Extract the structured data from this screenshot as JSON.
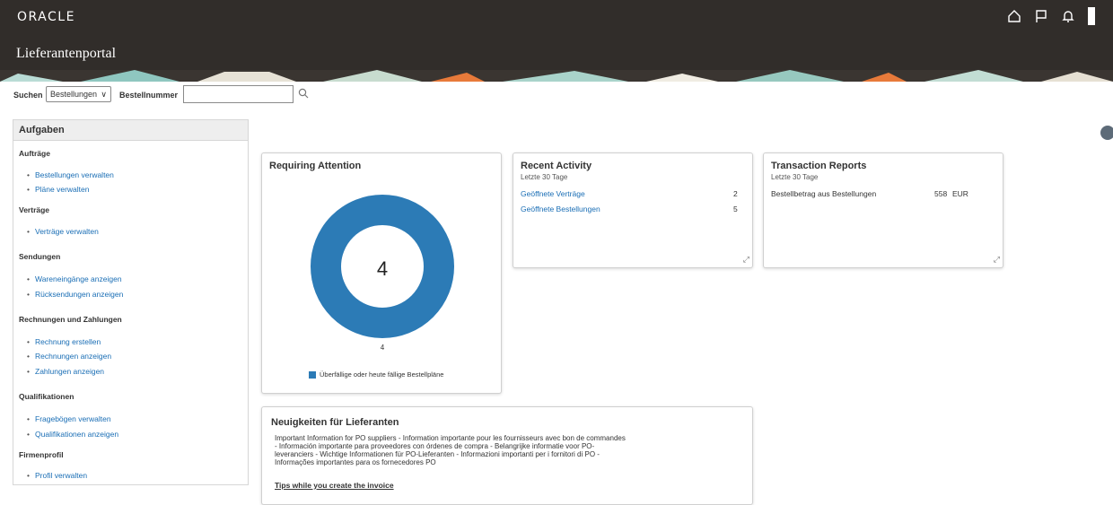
{
  "header": {
    "logo": "ORACLE",
    "app_title": "Lieferantenportal",
    "icons": [
      "home-icon",
      "flag-icon",
      "bell-icon"
    ]
  },
  "search": {
    "label": "Suchen",
    "selected": "Bestellungen",
    "field_label": "Bestellnummer",
    "value": ""
  },
  "tasks": {
    "title": "Aufgaben",
    "groups": [
      {
        "label": "Aufträge",
        "items": [
          "Bestellungen verwalten",
          "Pläne verwalten"
        ]
      },
      {
        "label": "Verträge",
        "items": [
          "Verträge verwalten"
        ]
      },
      {
        "label": "Sendungen",
        "items": [
          "Wareneingänge anzeigen",
          "Rücksendungen anzeigen"
        ]
      },
      {
        "label": "Rechnungen und Zahlungen",
        "items": [
          "Rechnung erstellen",
          "Rechnungen anzeigen",
          "Zahlungen anzeigen"
        ]
      },
      {
        "label": "Qualifikationen",
        "items": [
          "Fragebögen verwalten",
          "Qualifikationen anzeigen"
        ]
      },
      {
        "label": "Firmenprofil",
        "items": [
          "Profil verwalten"
        ]
      }
    ]
  },
  "requiring": {
    "title": "Requiring Attention",
    "center_value": "4",
    "bottom_value": "4",
    "legend": "Überfällige oder heute fällige Bestellpläne",
    "color": "#2c7bb6"
  },
  "recent": {
    "title": "Recent Activity",
    "subtitle": "Letzte 30 Tage",
    "rows": [
      {
        "label": "Geöffnete Verträge",
        "value": "2"
      },
      {
        "label": "Geöffnete Bestellungen",
        "value": "5"
      }
    ]
  },
  "reports": {
    "title": "Transaction Reports",
    "subtitle": "Letzte 30 Tage",
    "row_label": "Bestellbetrag aus Bestellungen",
    "row_value": "558",
    "row_currency": "EUR"
  },
  "news": {
    "title": "Neuigkeiten für Lieferanten",
    "lines": [
      "Important Information for PO suppliers - Information importante pour les fournisseurs avec bon de commandes",
      "- Información importante para proveedores con órdenes de compra - Belangrijke informatie voor PO-",
      "leveranciers - Wichtige Informationen für PO-Lieferanten - Informazioni importanti per i fornitori di PO -",
      "Informações importantes para os fornecedores PO"
    ],
    "link": "Tips while you create the invoice"
  }
}
